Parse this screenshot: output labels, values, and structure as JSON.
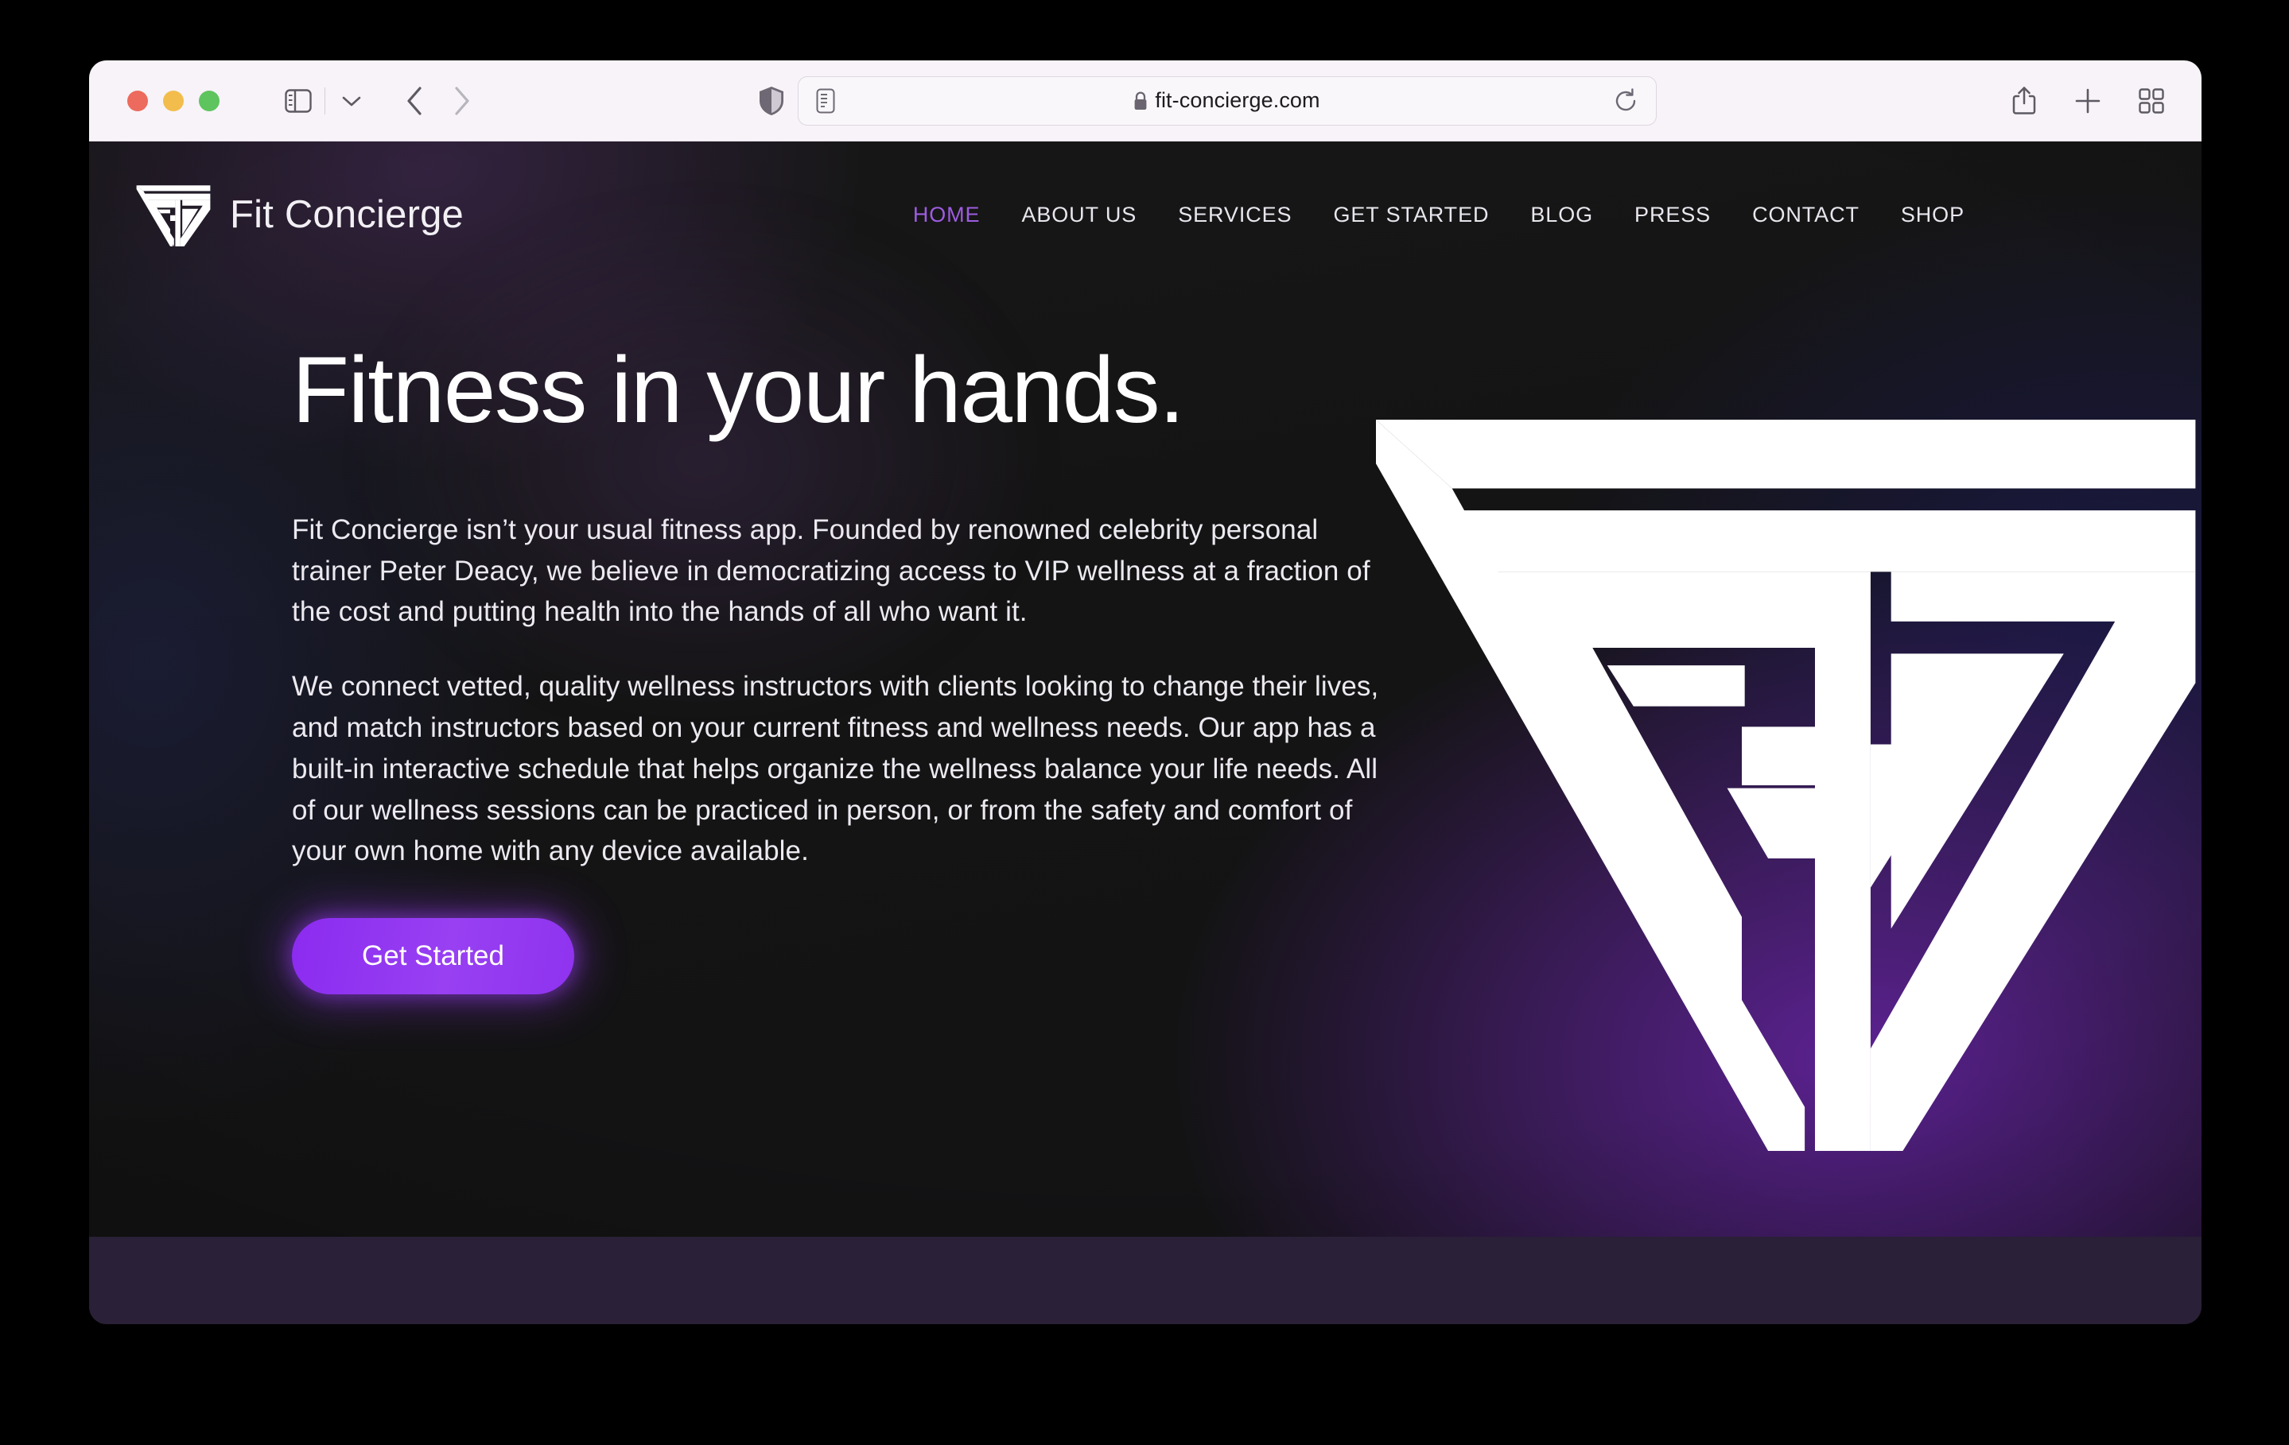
{
  "browser": {
    "url": "fit-concierge.com",
    "traffic_lights": [
      "close-red",
      "minimize-yellow",
      "maximize-green"
    ],
    "icons": {
      "sidebar": "sidebar-icon",
      "tab_dropdown": "chevron-down-icon",
      "back": "back-arrow-icon",
      "forward": "forward-arrow-icon",
      "shield": "privacy-shield-icon",
      "reader": "reader-view-icon",
      "lock": "lock-icon",
      "reload": "reload-icon",
      "share": "share-icon",
      "new_tab": "plus-icon",
      "tab_overview": "tab-overview-icon"
    }
  },
  "site": {
    "brand": {
      "name": "Fit Concierge",
      "logo": "fit-concierge-triangle-logo"
    },
    "nav": [
      {
        "label": "HOME",
        "active": true
      },
      {
        "label": "ABOUT US",
        "active": false
      },
      {
        "label": "SERVICES",
        "active": false
      },
      {
        "label": "GET STARTED",
        "active": false
      },
      {
        "label": "BLOG",
        "active": false
      },
      {
        "label": "PRESS",
        "active": false
      },
      {
        "label": "CONTACT",
        "active": false
      },
      {
        "label": "SHOP",
        "active": false
      }
    ],
    "hero": {
      "title": "Fitness in your hands.",
      "paragraph_1": "Fit Concierge isn’t your usual fitness app. Founded by renowned celebrity personal trainer Peter Deacy, we believe in democratizing access to VIP wellness at a fraction of the cost and putting health into the hands of all who want it.",
      "paragraph_2": "We connect vetted, quality wellness instructors with clients looking to change their lives, and match instructors based on your current fitness and wellness needs. Our app has a built-in interactive schedule that helps organize the wellness balance your life needs. All of our wellness sessions can be practiced in person, or from the safety and comfort of your own home with any device available.",
      "cta_label": "Get Started"
    },
    "colors": {
      "accent_purple": "#8b2bf0",
      "nav_active": "#9d5ce0",
      "page_background": "#151515",
      "bottom_band": "#2a2037",
      "text_primary": "#ffffff"
    }
  }
}
